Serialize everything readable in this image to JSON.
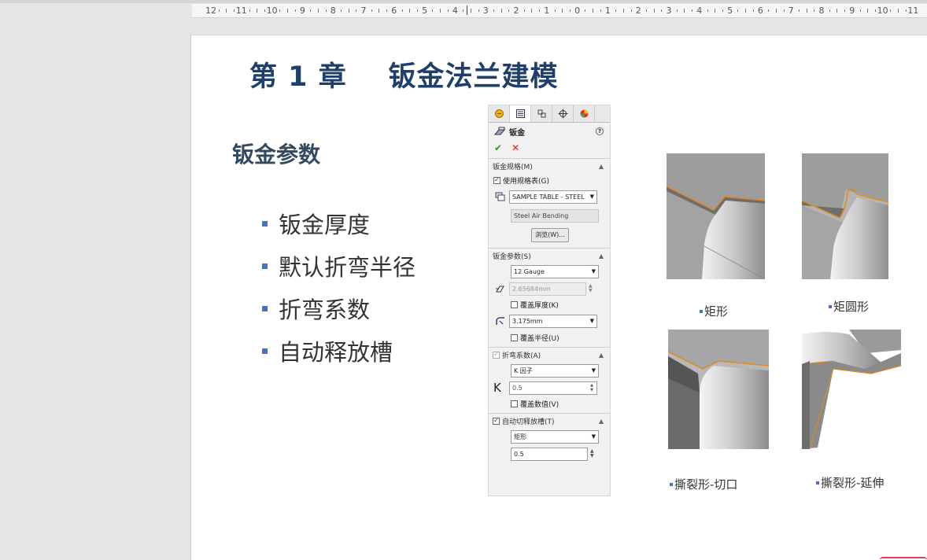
{
  "ruler": {
    "left_numbers": [
      "12",
      "11",
      "10",
      "9",
      "8",
      "7",
      "6",
      "5",
      "4",
      "3",
      "2",
      "1",
      "0",
      "1",
      "2",
      "3",
      "4",
      "5",
      "6",
      "7",
      "8",
      "9",
      "10",
      "11"
    ]
  },
  "slide": {
    "chapter_title": "第 1 章    钣金法兰建模",
    "section_title": "钣金参数",
    "bullets": [
      "钣金厚度",
      "默认折弯半径",
      "折弯系数",
      "自动释放槽"
    ]
  },
  "panel": {
    "tab_icons": [
      "feature-manager-icon",
      "property-manager-icon",
      "configuration-manager-icon",
      "dimxpert-icon",
      "appearance-icon"
    ],
    "title": "钣金",
    "help_label": "?",
    "ok_label": "✔",
    "cancel_label": "✕",
    "gauge": {
      "heading": "钣金规格(M)",
      "use_table_label": "使用规格表(G)",
      "use_table_checked": true,
      "table_value": "SAMPLE TABLE - STEEL",
      "bend_type_value": "Steel Air Bending",
      "browse_label": "浏览(W)..."
    },
    "params": {
      "heading": "钣金参数(S)",
      "gauge_value": "12 Gauge",
      "thickness_value": "2.65684mm",
      "override_thickness_label": "覆盖厚度(K)",
      "radius_value": "3.175mm",
      "override_radius_label": "覆盖半径(U)"
    },
    "allowance": {
      "heading": "折弯系数(A)",
      "type_value": "K 因子",
      "k_label": "K",
      "k_value": "0.5",
      "override_value_label": "覆盖数值(V)"
    },
    "relief": {
      "heading": "自动切释放槽(T)",
      "checked": true,
      "type_value": "矩形",
      "ratio_value": "0.5"
    }
  },
  "images": {
    "captions": [
      "矩形",
      "矩圆形",
      "撕裂形-切口",
      "撕裂形-延伸"
    ]
  },
  "colors": {
    "title_blue": "#1f3f6a",
    "bullet_blue": "#4472c4",
    "edge_orange": "#e08a20"
  }
}
